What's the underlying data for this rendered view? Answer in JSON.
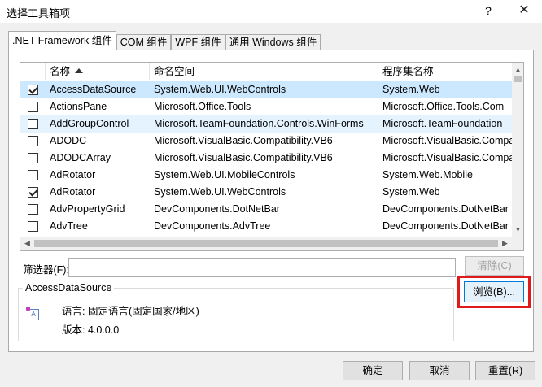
{
  "window": {
    "title": "选择工具箱项",
    "help": "?",
    "close": "✕"
  },
  "tabs": [
    {
      "label": ".NET Framework 组件",
      "active": true
    },
    {
      "label": "COM 组件",
      "active": false
    },
    {
      "label": "WPF 组件",
      "active": false
    },
    {
      "label": "通用 Windows 组件",
      "active": false
    }
  ],
  "grid": {
    "columns": {
      "name": "名称",
      "namespace": "命名空间",
      "assembly": "程序集名称"
    },
    "rows": [
      {
        "checked": true,
        "name": "AccessDataSource",
        "namespace": "System.Web.UI.WebControls",
        "assembly": "System.Web"
      },
      {
        "checked": false,
        "name": "ActionsPane",
        "namespace": "Microsoft.Office.Tools",
        "assembly": "Microsoft.Office.Tools.Com"
      },
      {
        "checked": false,
        "name": "AddGroupControl",
        "namespace": "Microsoft.TeamFoundation.Controls.WinForms",
        "assembly": "Microsoft.TeamFoundation"
      },
      {
        "checked": false,
        "name": "ADODC",
        "namespace": "Microsoft.VisualBasic.Compatibility.VB6",
        "assembly": "Microsoft.VisualBasic.Compat"
      },
      {
        "checked": false,
        "name": "ADODCArray",
        "namespace": "Microsoft.VisualBasic.Compatibility.VB6",
        "assembly": "Microsoft.VisualBasic.Compat"
      },
      {
        "checked": false,
        "name": "AdRotator",
        "namespace": "System.Web.UI.MobileControls",
        "assembly": "System.Web.Mobile"
      },
      {
        "checked": true,
        "name": "AdRotator",
        "namespace": "System.Web.UI.WebControls",
        "assembly": "System.Web"
      },
      {
        "checked": false,
        "name": "AdvPropertyGrid",
        "namespace": "DevComponents.DotNetBar",
        "assembly": "DevComponents.DotNetBar"
      },
      {
        "checked": false,
        "name": "AdvTree",
        "namespace": "DevComponents.AdvTree",
        "assembly": "DevComponents.DotNetBar"
      }
    ]
  },
  "filter": {
    "label": "筛选器(F):",
    "value": "",
    "clear_label": "清除(C)"
  },
  "browse_label": "浏览(B)...",
  "details": {
    "title": "AccessDataSource",
    "language": "语言:  固定语言(固定国家/地区)",
    "version": "版本:  4.0.0.0",
    "icon_text": "A"
  },
  "buttons": {
    "ok": "确定",
    "cancel": "取消",
    "reset": "重置(R)"
  }
}
